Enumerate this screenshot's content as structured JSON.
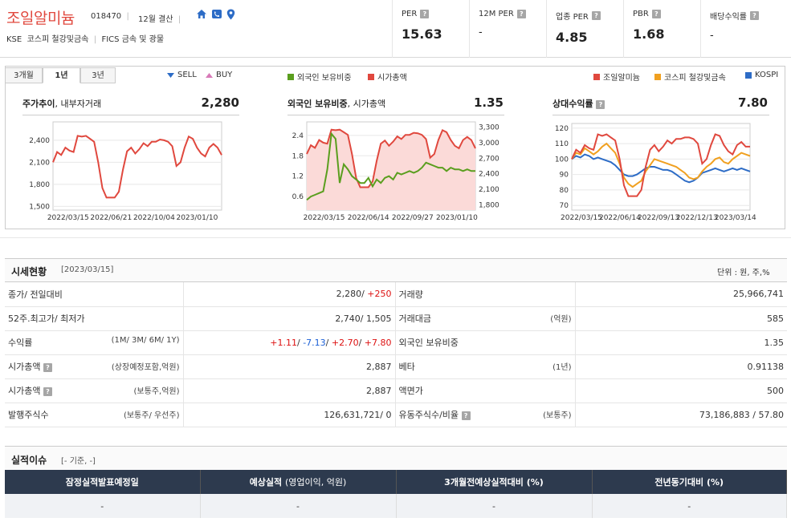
{
  "header": {
    "company_name": "조일알미늄",
    "code": "018470",
    "settlement": "12월 결산",
    "market": "KSE",
    "kse_sector": "코스피 철강및금속",
    "fics_sector": "FICS 금속 및 광물",
    "metrics": [
      {
        "label": "PER",
        "value": "15.63"
      },
      {
        "label": "12M PER",
        "value": "-"
      },
      {
        "label": "업종 PER",
        "value": "4.85"
      },
      {
        "label": "PBR",
        "value": "1.68"
      },
      {
        "label": "배당수익률",
        "value": "-"
      }
    ]
  },
  "tabs": [
    "3개월",
    "1년",
    "3년"
  ],
  "active_tab": "1년",
  "legend": {
    "sell": "SELL",
    "buy": "BUY",
    "foreign": "외국인 보유비중",
    "mktcap": "시가총액",
    "rel_company": "조일알미늄",
    "rel_sector": "코스피 철강및금속",
    "rel_kospi": "KOSPI"
  },
  "colors": {
    "red": "#e0483e",
    "green": "#5a9e1e",
    "orange": "#f0a020",
    "blue": "#2d6cc6",
    "fill": "#fbdad8"
  },
  "chart_data": [
    {
      "type": "line",
      "title": "주가추이",
      "subtitle": "내부자거래",
      "value": "2,280",
      "x_ticks": [
        "2022/03/15",
        "2022/06/21",
        "2022/10/04",
        "2023/01/10"
      ],
      "y_ticks": [
        1500,
        1800,
        2100,
        2400
      ],
      "ylim": [
        1450,
        2650
      ],
      "series": [
        {
          "values": [
            2100,
            2240,
            2200,
            2300,
            2260,
            2240,
            2460,
            2450,
            2460,
            2420,
            2380,
            2100,
            1750,
            1620,
            1620,
            1620,
            1700,
            2000,
            2250,
            2300,
            2220,
            2280,
            2360,
            2320,
            2380,
            2380,
            2410,
            2400,
            2380,
            2320,
            2050,
            2100,
            2300,
            2450,
            2420,
            2300,
            2220,
            2180,
            2300,
            2350,
            2300,
            2200
          ]
        }
      ]
    },
    {
      "type": "line",
      "title": "외국인 보유비중",
      "subtitle": "시가총액",
      "value": "1.35",
      "x_ticks": [
        "2022/03/15",
        "2022/06/14",
        "2022/09/27",
        "2023/01/10"
      ],
      "y_ticks_left": [
        0.6,
        1.2,
        1.8,
        2.4
      ],
      "y_ticks_right": [
        "1,800",
        "2,100",
        "2,400",
        "2,700",
        "3,000",
        "3,300"
      ],
      "ylim_left": [
        0.2,
        2.8
      ],
      "ylim_right": [
        1700,
        3400
      ],
      "series": [
        {
          "name": "외국인 보유비중",
          "values": [
            0.5,
            0.6,
            0.65,
            0.7,
            0.75,
            1.4,
            2.45,
            2.3,
            1.0,
            1.55,
            1.4,
            1.2,
            1.1,
            1.0,
            1.0,
            1.15,
            0.9,
            1.1,
            1.0,
            1.15,
            1.2,
            1.1,
            1.3,
            1.25,
            1.3,
            1.35,
            1.3,
            1.35,
            1.45,
            1.6,
            1.55,
            1.5,
            1.45,
            1.45,
            1.35,
            1.45,
            1.4,
            1.4,
            1.35,
            1.4,
            1.35,
            1.35
          ]
        },
        {
          "name": "시가총액",
          "values": [
            2780,
            2950,
            2900,
            3050,
            3000,
            2980,
            3250,
            3240,
            3250,
            3200,
            3150,
            2780,
            2320,
            2140,
            2140,
            2140,
            2250,
            2650,
            2980,
            3040,
            2940,
            3020,
            3120,
            3070,
            3150,
            3150,
            3190,
            3180,
            3150,
            3070,
            2710,
            2780,
            3050,
            3240,
            3200,
            3050,
            2940,
            2890,
            3050,
            3110,
            3050,
            2890
          ]
        }
      ]
    },
    {
      "type": "line",
      "title": "상대수익률",
      "value": "7.80",
      "x_ticks": [
        "2022/03/15",
        "2022/06/14",
        "2022/09/13",
        "2022/12/13",
        "2023/03/14"
      ],
      "y_ticks": [
        70,
        80,
        90,
        100,
        110,
        120
      ],
      "ylim": [
        67,
        123
      ],
      "series": [
        {
          "name": "조일알미늄",
          "values": [
            100,
            106,
            104,
            109,
            107,
            106,
            116,
            115,
            116,
            114,
            112,
            100,
            83,
            76,
            76,
            76,
            80,
            95,
            106,
            109,
            105,
            108,
            112,
            110,
            113,
            113,
            114,
            114,
            113,
            110,
            97,
            100,
            109,
            116,
            115,
            109,
            105,
            103,
            109,
            111,
            108,
            108
          ]
        },
        {
          "name": "코스피 철강및금속",
          "values": [
            100,
            104,
            103,
            107,
            105,
            103,
            105,
            108,
            110,
            107,
            104,
            97,
            88,
            84,
            82,
            84,
            86,
            92,
            96,
            100,
            99,
            98,
            97,
            96,
            95,
            93,
            91,
            88,
            87,
            88,
            92,
            95,
            97,
            100,
            101,
            98,
            97,
            100,
            102,
            104,
            103,
            102
          ]
        },
        {
          "name": "KOSPI",
          "values": [
            100,
            102,
            101,
            103,
            102,
            100,
            101,
            100,
            99,
            98,
            96,
            93,
            90,
            89,
            89,
            90,
            92,
            94,
            95,
            95,
            94,
            93,
            93,
            92,
            90,
            88,
            86,
            85,
            86,
            88,
            91,
            92,
            93,
            94,
            93,
            92,
            93,
            94,
            93,
            94,
            93,
            92
          ]
        }
      ]
    }
  ],
  "status": {
    "title": "시세현황",
    "date": "[2023/03/15]",
    "unit": "단위 : 원, 주,%",
    "rows": [
      {
        "l1": "종가/ 전일대비",
        "l1sub": "",
        "v1a": "2,280/ ",
        "v1b": "+250",
        "l2": "거래량",
        "l2sub": "",
        "v2": "25,966,741"
      },
      {
        "l1": "52주.최고가/ 최저가",
        "l1sub": "",
        "v1a": "2,740/ 1,505",
        "v1b": "",
        "l2": "거래대금",
        "l2sub": "(억원)",
        "v2": "585"
      },
      {
        "l1": "수익률",
        "l1sub": "(1M/ 3M/ 6M/ 1Y)",
        "l2": "외국인 보유비중",
        "l2sub": "",
        "v2": "1.35"
      },
      {
        "l1": "시가총액",
        "l1sub": "(상장예정포함,억원)",
        "v1a": "2,887",
        "v1b": "",
        "l2": "베타",
        "l2sub": "(1년)",
        "v2": "0.91138"
      },
      {
        "l1": "시가총액",
        "l1sub": "(보통주,억원)",
        "v1a": "2,887",
        "v1b": "",
        "l2": "액면가",
        "l2sub": "",
        "v2": "500"
      },
      {
        "l1": "발행주식수",
        "l1sub": "(보통주/ 우선주)",
        "v1a": "126,631,721/ 0",
        "v1b": "",
        "l2": "유동주식수/비율",
        "l2sub": "(보통주)",
        "v2": "73,186,883 / 57.80"
      }
    ],
    "returns": [
      "+1.11",
      "-7.13",
      "+2.70",
      "+7.80"
    ]
  },
  "results": {
    "title": "실적이슈",
    "sub": "[- 기준, -]",
    "headers": [
      "잠정실적발표예정일",
      "예상실적",
      "3개월전예상실적대비 (%)",
      "전년동기대비 (%)"
    ],
    "header2_sub": "(영업이익, 억원)",
    "values": [
      "-",
      "-",
      "-",
      "-"
    ]
  }
}
